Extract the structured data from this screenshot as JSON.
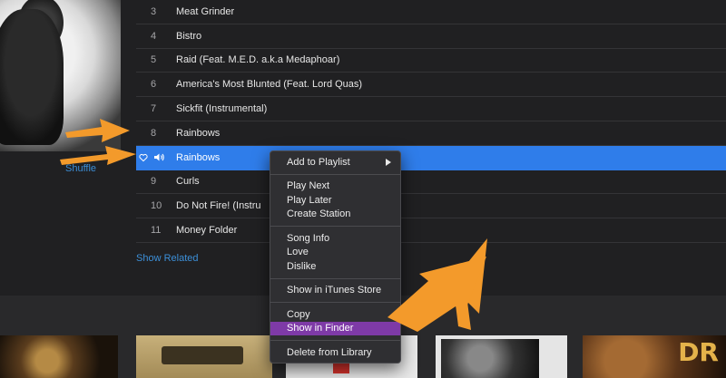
{
  "tracks": [
    {
      "num": "3",
      "title": "Meat Grinder"
    },
    {
      "num": "4",
      "title": "Bistro"
    },
    {
      "num": "5",
      "title": "Raid (Feat. M.E.D. a.k.a Medaphoar)"
    },
    {
      "num": "6",
      "title": "America's Most Blunted (Feat. Lord Quas)"
    },
    {
      "num": "7",
      "title": "Sickfit (Instrumental)"
    },
    {
      "num": "8",
      "title": "Rainbows"
    },
    {
      "num": "",
      "title": "Rainbows"
    },
    {
      "num": "9",
      "title": "Curls"
    },
    {
      "num": "10",
      "title": "Do Not Fire! (Instru"
    },
    {
      "num": "11",
      "title": "Money Folder"
    }
  ],
  "shuffle_label": "Shuffle",
  "show_related_label": "Show Related",
  "context_menu": {
    "add_to_playlist": "Add to Playlist",
    "play_next": "Play Next",
    "play_later": "Play Later",
    "create_station": "Create Station",
    "song_info": "Song Info",
    "love": "Love",
    "dislike": "Dislike",
    "show_in_itunes_store": "Show in iTunes Store",
    "copy": "Copy",
    "show_in_finder": "Show in Finder",
    "delete_from_library": "Delete from Library"
  },
  "thumbnail_text": {
    "t5_letters": "DR"
  },
  "colors": {
    "accent_blue": "#2f7dea",
    "link_blue": "#3c8fd8",
    "menu_highlight": "#7e3aa7",
    "arrow_orange": "#f39a2b"
  },
  "icons": {
    "heart": "heart-icon",
    "speaker": "speaker-icon",
    "submenu": "chevron-right-icon"
  }
}
